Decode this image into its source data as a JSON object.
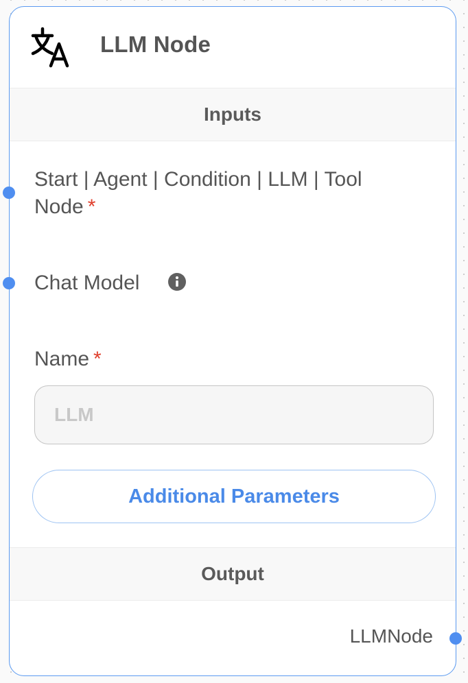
{
  "node": {
    "title": "LLM Node",
    "icon": "translate-icon",
    "border_color": "#5b9af0",
    "handle_color": "#4f8ef0"
  },
  "inputs_section": {
    "title": "Inputs",
    "anchor_label": "Start | Agent | Condition | LLM | Tool Node",
    "anchor_required": "*",
    "chat_model_label": "Chat Model",
    "chat_model_info_icon": "info-icon",
    "name_label": "Name",
    "name_required": "*",
    "name_input_value": "",
    "name_input_placeholder": "LLM",
    "additional_params_label": "Additional Parameters",
    "accent_color": "#4a8ae8",
    "required_color": "#e0402e"
  },
  "output_section": {
    "title": "Output",
    "output_label": "LLMNode"
  }
}
